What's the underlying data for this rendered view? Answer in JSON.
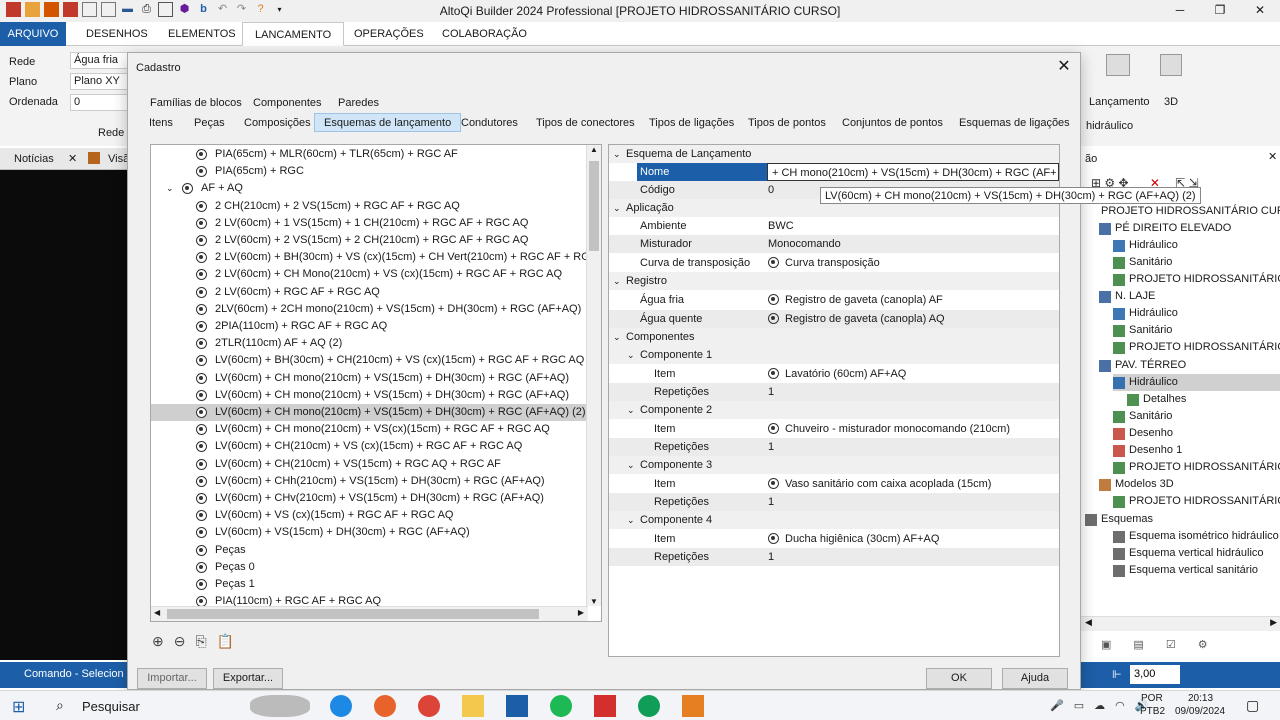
{
  "app": {
    "title": "AltoQi Builder 2024 Professional [PROJETO HIDROSSANITÁRIO CURSO]"
  },
  "ribbon": {
    "tabs": [
      "ARQUIVO",
      "DESENHOS",
      "ELEMENTOS",
      "LANCAMENTO",
      "OPERAÇÕES",
      "COLABORAÇÃO"
    ],
    "rede_label": "Rede",
    "rede_value": "Água fria",
    "plano_label": "Plano",
    "plano_value": "Plano XY",
    "ordenada_label": "Ordenada",
    "ordenada_value": "0",
    "rede_group": "Rede",
    "lancamento_label": "Lançamento",
    "hidraulico_label": "hidráulico",
    "view3d_label": "3D"
  },
  "left_panel": {
    "tab1": "Notícias",
    "tab2": "Visã"
  },
  "status": {
    "text": "Comando - Selecion"
  },
  "dialog": {
    "title": "Cadastro",
    "groups": [
      "Famílias de blocos",
      "Componentes",
      "Paredes"
    ],
    "tabs": [
      "Itens",
      "Peças",
      "Composições",
      "Esquemas de lançamento",
      "Condutores",
      "Tipos de conectores",
      "Tipos de ligações",
      "Tipos de pontos",
      "Conjuntos de pontos",
      "Esquemas de ligações"
    ],
    "tree": [
      "PIA(65cm) + MLR(60cm) + TLR(65cm) + RGC AF",
      "PIA(65cm) + RGC",
      "AF + AQ",
      "2 CH(210cm) + 2 VS(15cm) + RGC AF + RGC AQ",
      "2 LV(60cm) + 1 VS(15cm) + 1 CH(210cm) + RGC AF + RGC AQ",
      "2 LV(60cm) + 2 VS(15cm) + 2 CH(210cm) + RGC AF + RGC AQ",
      "2 LV(60cm) + BH(30cm) + VS (cx)(15cm) + CH Vert(210cm) + RGC AF + RG",
      "2 LV(60cm) + CH Mono(210cm) + VS (cx)(15cm) + RGC AF + RGC AQ",
      "2 LV(60cm) + RGC AF + RGC AQ",
      "2LV(60cm) + 2CH mono(210cm) + VS(15cm) + DH(30cm) + RGC (AF+AQ)",
      "2PIA(110cm) + RGC AF + RGC AQ",
      "2TLR(110cm) AF + AQ (2)",
      "LV(60cm) + BH(30cm) + CH(210cm) + VS (cx)(15cm) + RGC AF + RGC AQ",
      "LV(60cm) + CH mono(210cm) + VS(15cm) + DH(30cm) + RGC (AF+AQ)",
      "LV(60cm) + CH mono(210cm) + VS(15cm) + DH(30cm) + RGC (AF+AQ)",
      "LV(60cm) + CH mono(210cm) + VS(15cm) + DH(30cm) + RGC (AF+AQ) (2)",
      "LV(60cm) + CH mono(210cm) + VS(cx)(15cm) + RGC AF + RGC AQ",
      "LV(60cm) + CH(210cm) + VS (cx)(15cm) + RGC AF + RGC AQ",
      "LV(60cm) + CH(210cm) + VS(15cm) + RGC AQ + RGC AF",
      "LV(60cm) + CHh(210cm) + VS(15cm) + DH(30cm) + RGC (AF+AQ)",
      "LV(60cm) + CHv(210cm) + VS(15cm) + DH(30cm) + RGC (AF+AQ)",
      "LV(60cm) + VS (cx)(15cm) + RGC AF + RGC AQ",
      "LV(60cm) + VS(15cm) + DH(30cm) + RGC (AF+AQ)",
      "Peças",
      "Peças 0",
      "Peças 1",
      "PIA(110cm) + RGC AF + RGC AQ"
    ],
    "props": {
      "cat_esquema": "Esquema de Lançamento",
      "nome_k": "Nome",
      "nome_v": "+ CH mono(210cm) + VS(15cm) + DH(30cm) + RGC (AF+",
      "codigo_k": "Código",
      "codigo_v": "0",
      "cat_aplicacao": "Aplicação",
      "ambiente_k": "Ambiente",
      "ambiente_v": "BWC",
      "misturador_k": "Misturador",
      "misturador_v": "Monocomando",
      "curva_k": "Curva de transposição",
      "curva_v": "Curva transposição",
      "cat_registro": "Registro",
      "aguafria_k": "Água fria",
      "aguafria_v": "Registro de gaveta (canopla) AF",
      "aguaquente_k": "Água quente",
      "aguaquente_v": "Registro de gaveta (canopla) AQ",
      "cat_componentes": "Componentes",
      "c1": "Componente 1",
      "c1_item": "Lavatório (60cm) AF+AQ",
      "c1_rep": "1",
      "c2": "Componente 2",
      "c2_item": "Chuveiro - misturador monocomando (210cm)",
      "c2_rep": "1",
      "c3": "Componente 3",
      "c3_item": "Vaso sanitário com caixa acoplada (15cm)",
      "c3_rep": "1",
      "c4": "Componente 4",
      "c4_item": "Ducha higiênica (30cm) AF+AQ",
      "c4_rep": "1",
      "item_k": "Item",
      "rep_k": "Repetições"
    },
    "tooltip": "LV(60cm) + CH mono(210cm) + VS(15cm) + DH(30cm) + RGC (AF+AQ) (2)",
    "importar": "Importar...",
    "exportar": "Exportar...",
    "ok": "OK",
    "ajuda": "Ajuda"
  },
  "right_panel": {
    "items": [
      "PROJETO HIDROSSANITÁRIO CURSO",
      "PÉ DIREITO ELEVADO",
      "Hidráulico",
      "Sanitário",
      "PROJETO HIDROSSANITÁRIO CUR",
      "N. LAJE",
      "Hidráulico",
      "Sanitário",
      "PROJETO HIDROSSANITÁRIO CUR",
      "PAV. TÉRREO",
      "Hidráulico",
      "Detalhes",
      "Sanitário",
      "Desenho",
      "Desenho 1",
      "PROJETO HIDROSSANITÁRIO CUR",
      "Modelos 3D",
      "PROJETO HIDROSSANITÁRIO CUR",
      "Esquemas",
      "Esquema isométrico hidráulico",
      "Esquema vertical hidráulico",
      "Esquema vertical sanitário"
    ],
    "zoom": "3,00"
  },
  "taskbar": {
    "search": "Pesquisar",
    "lang1": "POR",
    "lang2": "PTB2",
    "time": "20:13",
    "date": "09/09/2024"
  }
}
